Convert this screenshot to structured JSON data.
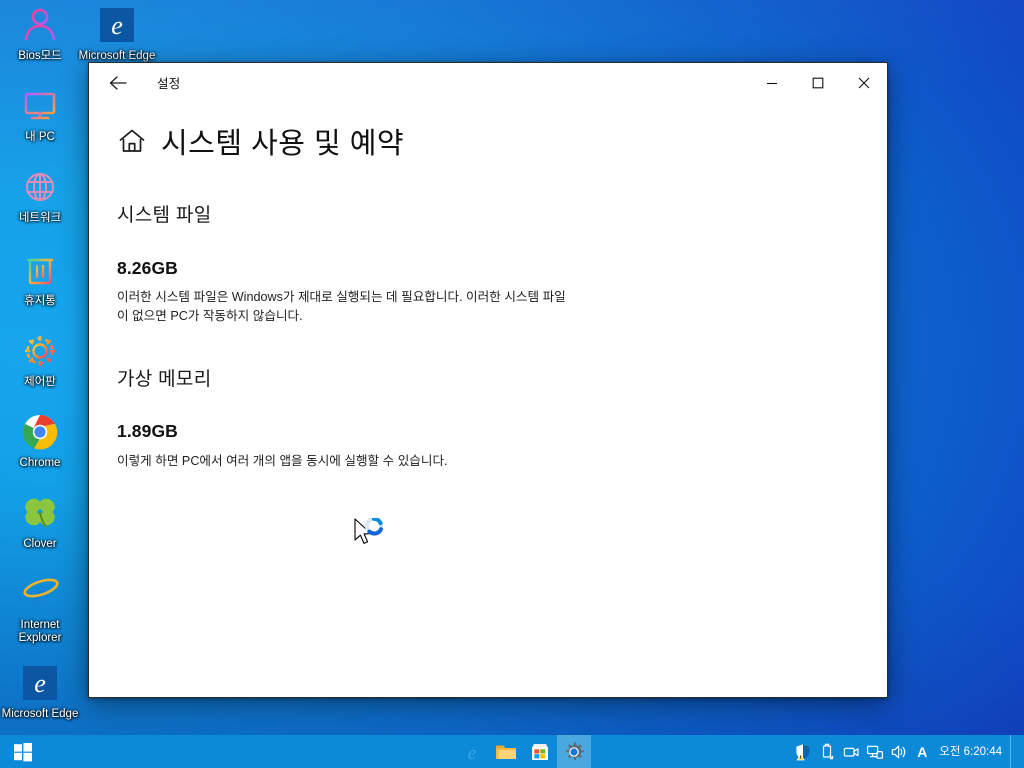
{
  "desktop": {
    "icons": [
      {
        "label": "Bios모드",
        "icon": "user-person-icon"
      },
      {
        "label": "내 PC",
        "icon": "monitor-icon"
      },
      {
        "label": "네트워크",
        "icon": "globe-network-icon"
      },
      {
        "label": "휴지통",
        "icon": "recycle-bin-icon"
      },
      {
        "label": "제어판",
        "icon": "gear-control-panel-icon"
      },
      {
        "label": "Chrome",
        "icon": "chrome-icon"
      },
      {
        "label": "Clover",
        "icon": "clover-leaf-icon"
      },
      {
        "label": "Internet Explorer",
        "icon": "internet-explorer-icon"
      },
      {
        "label": "Microsoft Edge",
        "icon": "microsoft-edge-icon"
      }
    ],
    "top_icon": {
      "label": "Microsoft Edge",
      "icon": "microsoft-edge-icon"
    }
  },
  "window": {
    "title": "설정",
    "back_label": "←",
    "minimize_label": "─",
    "maximize_label": "☐",
    "close_label": "✕",
    "page_title": "시스템 사용 및 예약",
    "home_icon": "home-icon"
  },
  "main": {
    "sections": [
      {
        "heading": "시스템 파일",
        "value": "8.26GB",
        "description": "이러한 시스템 파일은 Windows가 제대로 실행되는 데 필요합니다. 이러한 시스템 파일이 없으면 PC가 작동하지 않습니다."
      },
      {
        "heading": "가상 메모리",
        "value": "1.89GB",
        "description": "이렇게 하면 PC에서 여러 개의 앱을 동시에 실행할 수 있습니다."
      }
    ]
  },
  "taskbar": {
    "start_label": "start-button",
    "apps": [
      {
        "name": "Microsoft Edge",
        "icon": "edge-icon",
        "active": false
      },
      {
        "name": "파일 탐색기",
        "icon": "file-explorer-icon",
        "active": false
      },
      {
        "name": "Microsoft Store",
        "icon": "store-icon",
        "active": false
      },
      {
        "name": "설정",
        "icon": "settings-gear-icon",
        "active": true
      }
    ],
    "tray": [
      {
        "name": "보안 및 유지 관리",
        "icon": "security-shield-warning-icon"
      },
      {
        "name": "하드웨어 안전하게 제거",
        "icon": "usb-eject-icon"
      },
      {
        "name": "카메라",
        "icon": "camera-icon"
      },
      {
        "name": "네트워크",
        "icon": "network-icon"
      },
      {
        "name": "볼륨",
        "icon": "speaker-volume-icon"
      }
    ],
    "ime": "A",
    "clock_period": "오전",
    "clock_time": "6:20:44"
  },
  "colors": {
    "desktop_left": "#12a0e8",
    "desktop_right": "#1144c3",
    "taskbar": "#0c8ad7",
    "window_bg": "#ffffff",
    "text": "#111111"
  }
}
